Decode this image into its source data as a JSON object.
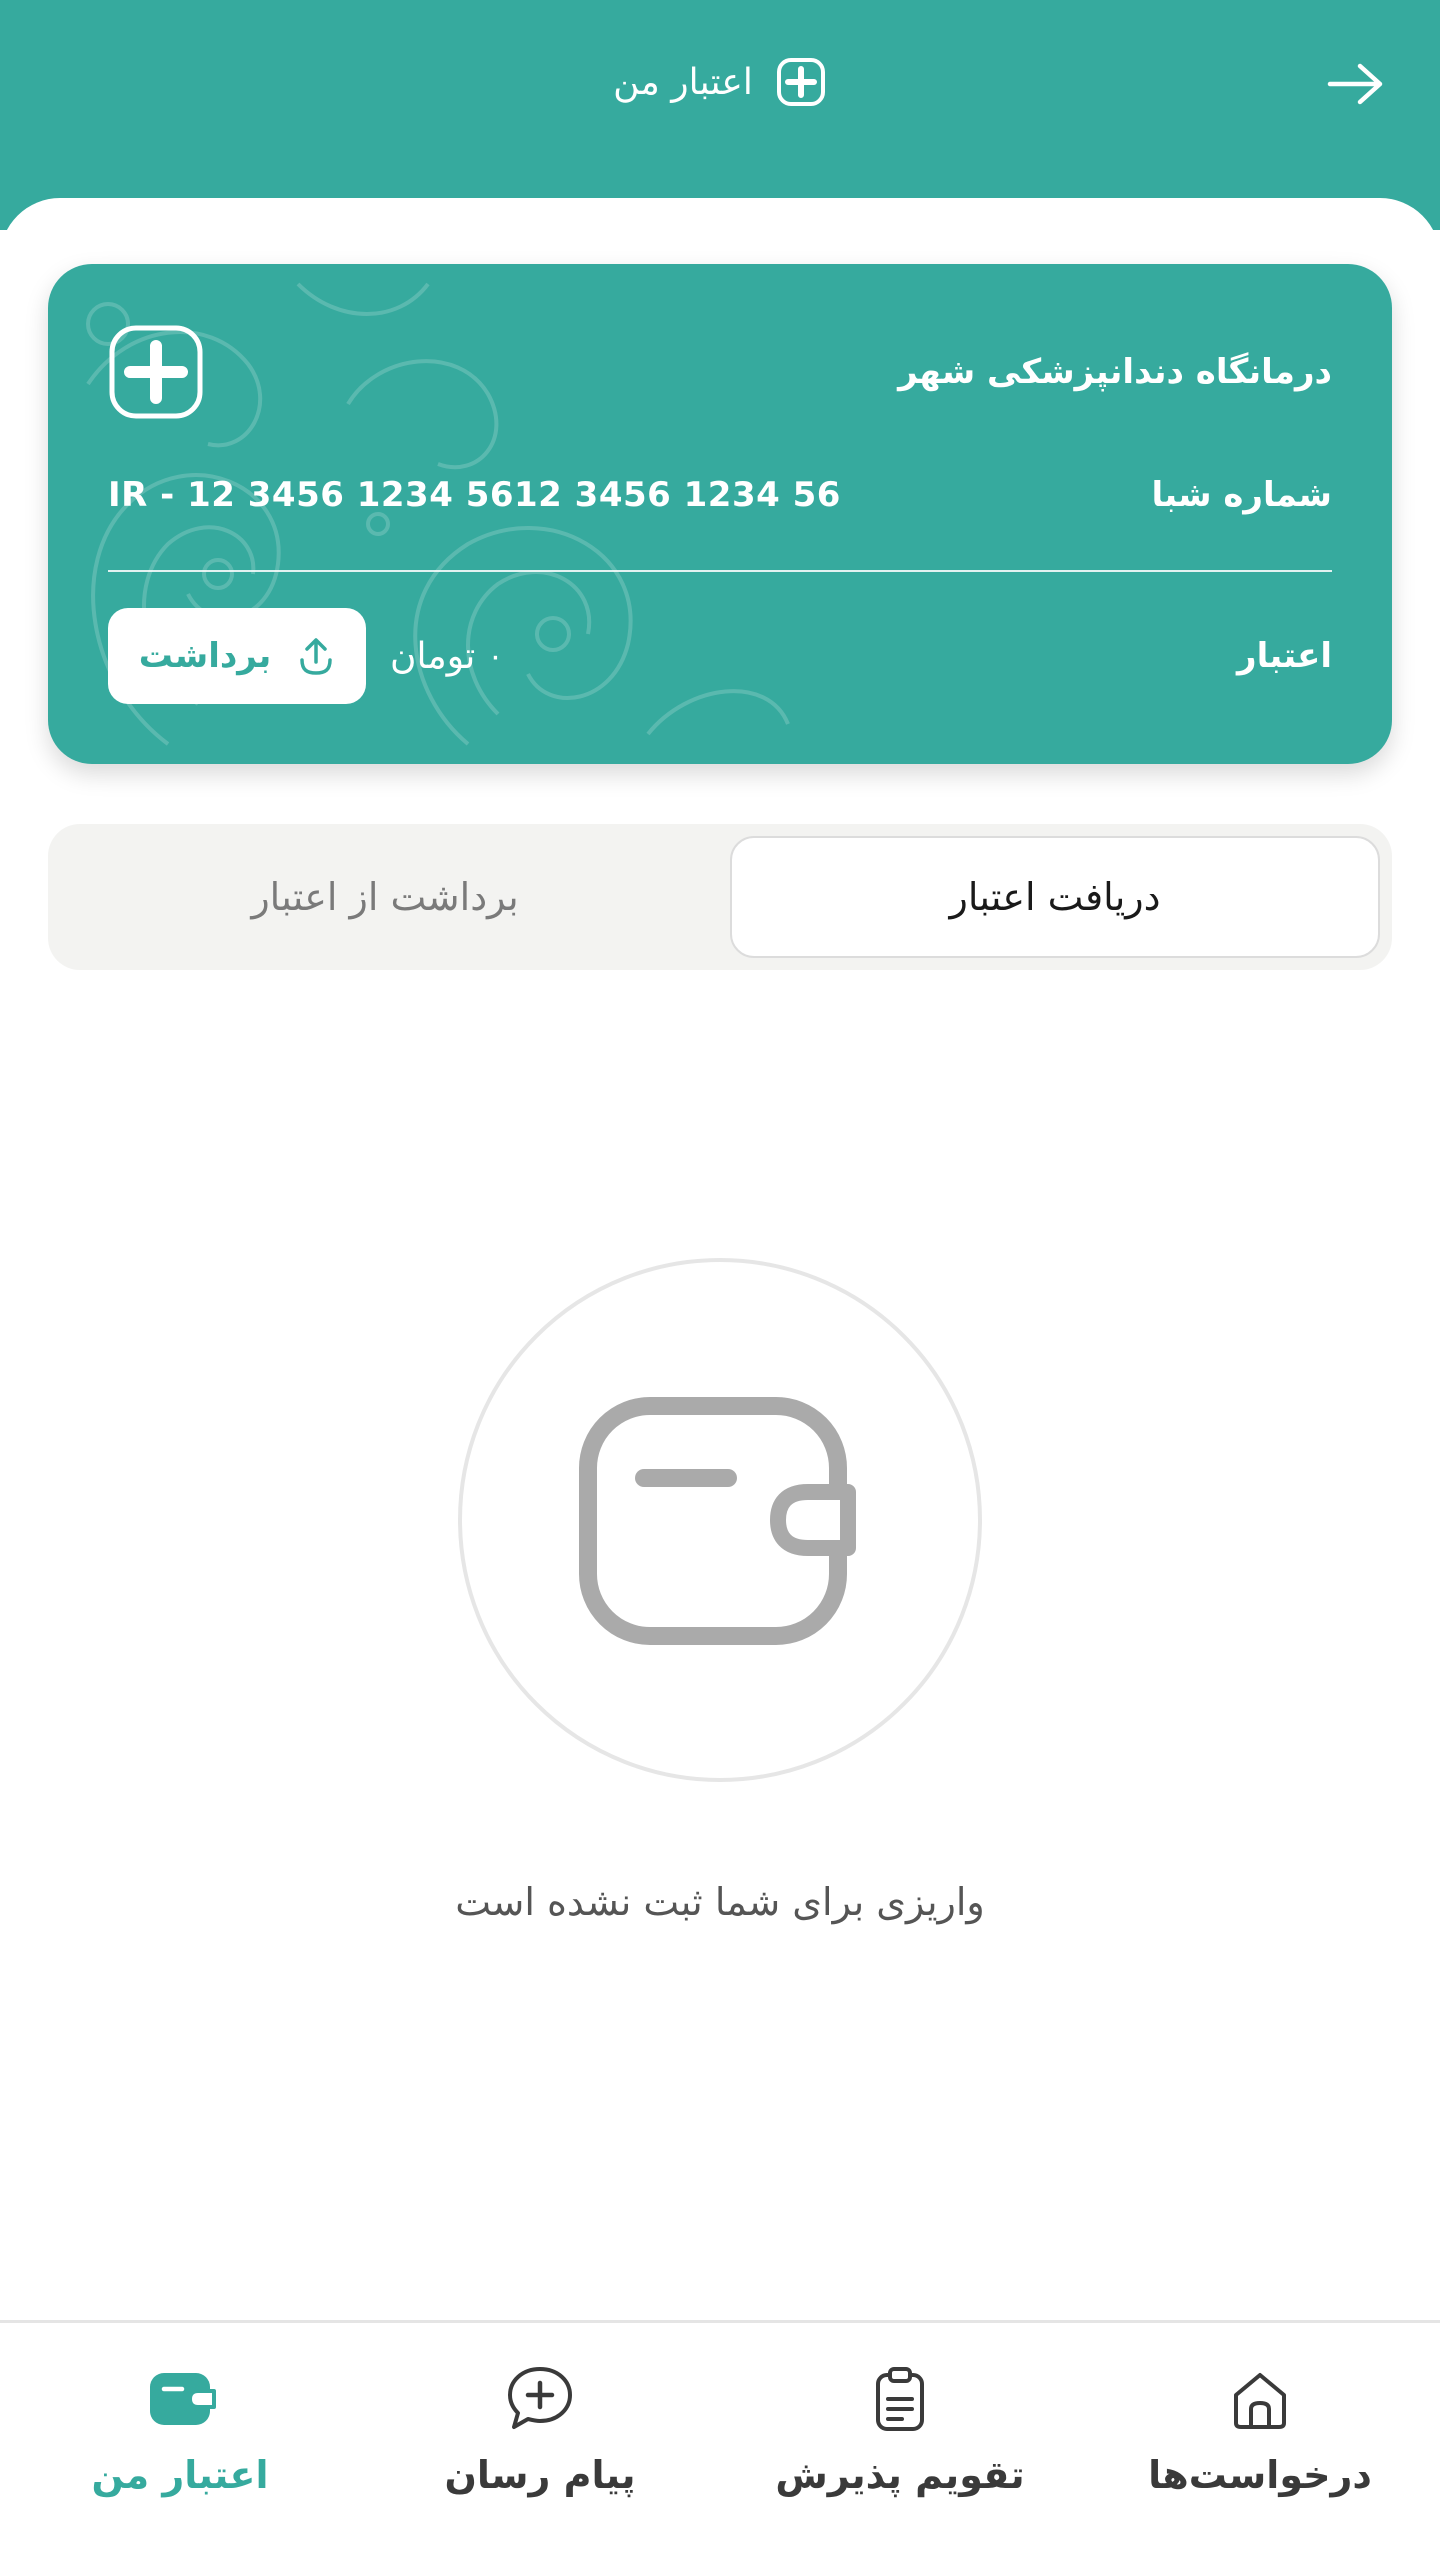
{
  "header": {
    "title": "اعتبار من",
    "title_icon": "plus-square-icon",
    "back_icon": "arrow-right-icon"
  },
  "card": {
    "clinic_name": "درمانگاه دندانپزشکی شهر",
    "sheba_label": "شماره شبا",
    "sheba_number": "IR - 12 3456 1234 5612 3456 1234 56",
    "credit_label": "اعتبار",
    "amount_value": "۰",
    "amount_unit": "تومان",
    "withdraw_label": "برداشت",
    "withdraw_icon": "upload-arrow-icon",
    "logo_icon": "plus-logo-icon"
  },
  "tabs": {
    "active": "دریافت اعتبار",
    "inactive": "برداشت از اعتبار"
  },
  "empty_state": {
    "icon": "wallet-icon",
    "message": "واریزی برای شما ثبت نشده است"
  },
  "bottom_nav": {
    "items": [
      {
        "label": "درخواست‌ها",
        "icon": "home-icon"
      },
      {
        "label": "تقویم پذیرش",
        "icon": "clipboard-icon"
      },
      {
        "label": "پیام رسان",
        "icon": "chat-plus-icon"
      },
      {
        "label": "اعتبار من",
        "icon": "wallet-icon",
        "active": true
      }
    ]
  },
  "colors": {
    "primary": "#36aa9e",
    "tab_bg": "#f3f3f1",
    "muted_text": "#7a7a7a"
  }
}
